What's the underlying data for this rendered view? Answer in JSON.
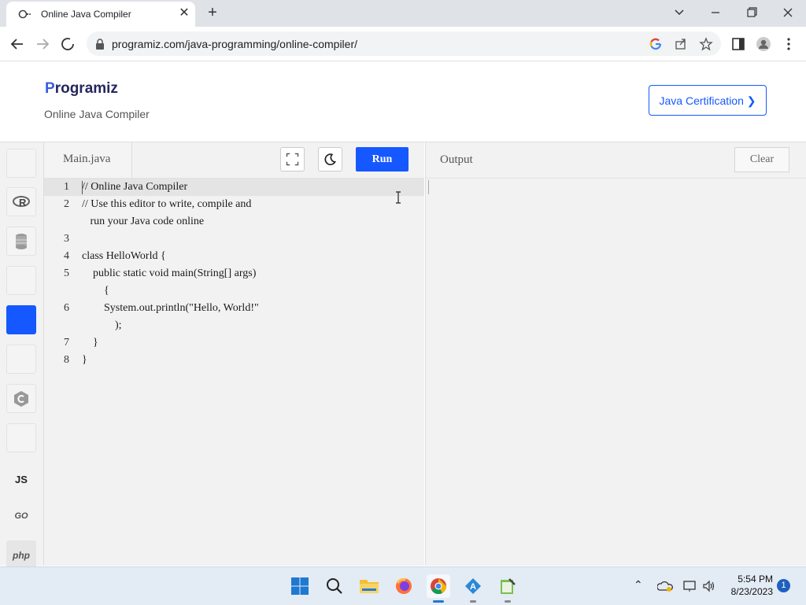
{
  "browser": {
    "tab_title": "Online Java Compiler",
    "url": "programiz.com/java-programming/online-compiler/"
  },
  "site": {
    "logo_text": "rogramiz",
    "logo_letter": "P",
    "subtitle": "Online Java Compiler",
    "certification_button": "Java Certification ❯"
  },
  "rail": {
    "items": [
      {
        "name": "python-lang-icon",
        "label": ""
      },
      {
        "name": "r-lang-icon",
        "label": "R"
      },
      {
        "name": "sql-lang-icon",
        "label": ""
      },
      {
        "name": "c-lang-icon",
        "label": ""
      },
      {
        "name": "java-lang-icon",
        "label": ""
      },
      {
        "name": "cpp-lang-icon",
        "label": ""
      },
      {
        "name": "csharp-lang-icon",
        "label": ""
      },
      {
        "name": "swift-lang-icon",
        "label": ""
      },
      {
        "name": "js-lang-icon",
        "label": "JS"
      },
      {
        "name": "go-lang-icon",
        "label": "GO"
      },
      {
        "name": "php-lang-icon",
        "label": "php"
      }
    ]
  },
  "editor": {
    "file_name": "Main.java",
    "run_label": "Run",
    "lines": [
      {
        "num": "1",
        "text": "// Online Java Compiler"
      },
      {
        "num": "2",
        "text": "// Use this editor to write, compile and"
      },
      {
        "num": "",
        "text": "   run your Java code online"
      },
      {
        "num": "3",
        "text": ""
      },
      {
        "num": "4",
        "text": "class HelloWorld {"
      },
      {
        "num": "5",
        "text": "    public static void main(String[] args)"
      },
      {
        "num": "",
        "text": "        {"
      },
      {
        "num": "6",
        "text": "        System.out.println(\"Hello, World!\""
      },
      {
        "num": "",
        "text": "            );"
      },
      {
        "num": "7",
        "text": "    }"
      },
      {
        "num": "8",
        "text": "}"
      }
    ]
  },
  "output": {
    "title": "Output",
    "clear_label": "Clear"
  },
  "taskbar": {
    "time": "5:54 PM",
    "date": "8/23/2023",
    "notification_count": "1"
  },
  "colors": {
    "accent": "#1658ff",
    "editor_bg": "#f2f2f2"
  }
}
